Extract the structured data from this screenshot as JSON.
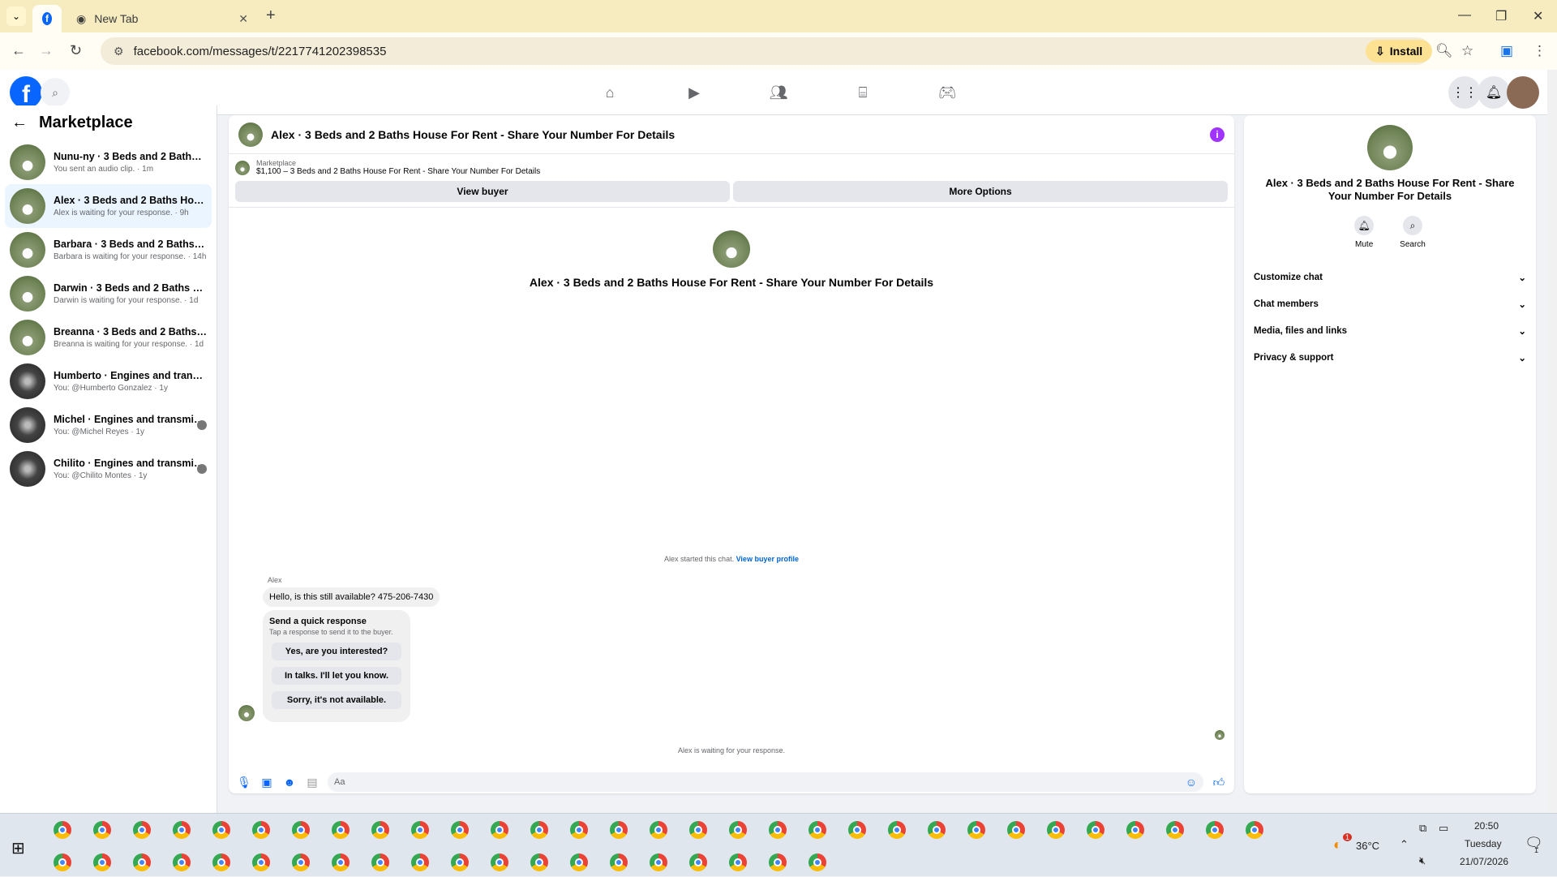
{
  "browser": {
    "tab_active_icon": "facebook-favicon",
    "tab_inactive_title": "New Tab",
    "url": "facebook.com/messages/t/2217741202398535",
    "install_label": "Install"
  },
  "sidebar": {
    "title": "Marketplace",
    "conversations": [
      {
        "name": "Nunu-ny · 3 Beds and 2 Baths Hou...",
        "sub": "You sent an audio clip. · 1m"
      },
      {
        "name": "Alex · 3 Beds and 2 Baths House F...",
        "sub": "Alex is waiting for your response. · 9h"
      },
      {
        "name": "Barbara · 3 Beds and 2 Baths Hous...",
        "sub": "Barbara is waiting for your response. · 14h"
      },
      {
        "name": "Darwin · 3 Beds and 2 Baths Hous...",
        "sub": "Darwin is waiting for your response. · 1d"
      },
      {
        "name": "Breanna · 3 Beds and 2 Baths Hous...",
        "sub": "Breanna is waiting for your response. · 1d"
      },
      {
        "name": "Humberto · Engines and transmiss...",
        "sub": "You: @Humberto Gonzalez · 1y"
      },
      {
        "name": "Michel · Engines and transmissi...",
        "sub": "You: @Michel Reyes · 1y"
      },
      {
        "name": "Chilito · Engines and transmissio...",
        "sub": "You: @Chilito Montes · 1y"
      }
    ]
  },
  "chat": {
    "title": "Alex · 3 Beds and 2 Baths House For Rent - Share Your Number For Details",
    "marketplace_label": "Marketplace",
    "listing": "$1,100 – 3 Beds and 2 Baths House For Rent - Share Your Number For Details",
    "view_buyer": "View buyer",
    "more_options": "More Options",
    "intro_title": "Alex · 3 Beds and 2 Baths House For Rent - Share Your Number For Details",
    "started_text": "Alex started this chat.",
    "view_buyer_profile": "View buyer profile",
    "sender": "Alex",
    "message": "Hello, is this still available? 475-206-7430",
    "quick_title": "Send a quick response",
    "quick_sub": "Tap a response to send it to the buyer.",
    "quick_options": [
      "Yes, are you interested?",
      "In talks. I'll let you know.",
      "Sorry, it's not available."
    ],
    "waiting": "Alex is waiting for your response.",
    "input_placeholder": "Aa"
  },
  "rpanel": {
    "title": "Alex · 3 Beds and 2 Baths House For Rent - Share Your Number For Details",
    "mute": "Mute",
    "search": "Search",
    "sections": [
      "Customize chat",
      "Chat members",
      "Media, files and links",
      "Privacy & support"
    ]
  },
  "taskbar": {
    "temp": "36°C",
    "time": "20:50",
    "day": "Tuesday",
    "date": "21/07/2026",
    "weather_badge": "1",
    "notif_count": "1"
  }
}
